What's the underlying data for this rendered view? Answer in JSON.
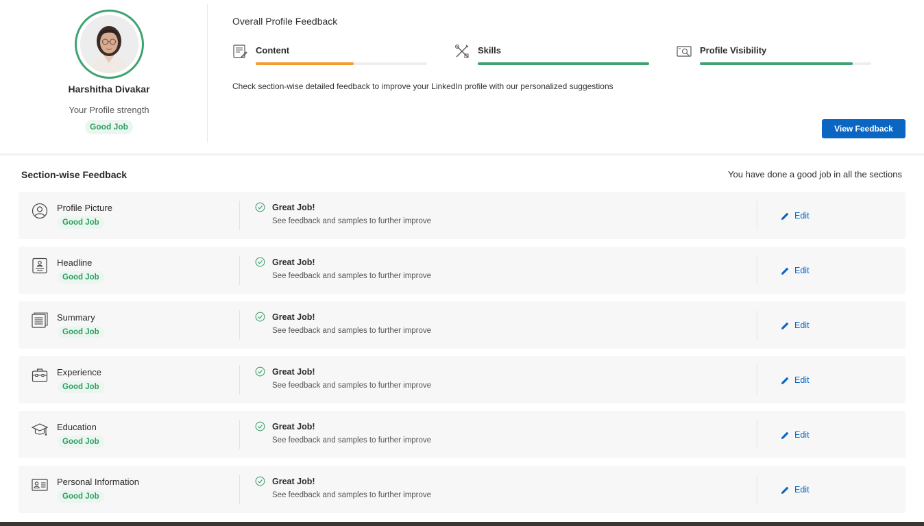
{
  "profile": {
    "name": "Harshitha Divakar",
    "strength_label": "Your Profile strength",
    "strength_badge": "Good Job",
    "ring_color": "#3ea36f"
  },
  "overall": {
    "title": "Overall Profile Feedback",
    "description": "Check section-wise detailed feedback to improve your LinkedIn profile with our personalized suggestions",
    "metrics": [
      {
        "label": "Content",
        "icon": "content-icon",
        "progress": 0.57,
        "color": "#f39c2f"
      },
      {
        "label": "Skills",
        "icon": "skills-icon",
        "progress": 1.0,
        "color": "#3ea36f"
      },
      {
        "label": "Profile Visibility",
        "icon": "profile-visibility-icon",
        "progress": 0.89,
        "color": "#3ea36f"
      }
    ],
    "view_button": "View Feedback"
  },
  "sections": {
    "title": "Section-wise Feedback",
    "summary": "You have done a good job in all the sections",
    "items": [
      {
        "name": "Profile Picture",
        "icon": "profile-picture-icon",
        "badge": "Good Job",
        "status": "Great Job!",
        "desc": "See feedback and samples to further improve",
        "edit": "Edit"
      },
      {
        "name": "Headline",
        "icon": "headline-icon",
        "badge": "Good Job",
        "status": "Great Job!",
        "desc": "See feedback and samples to further improve",
        "edit": "Edit"
      },
      {
        "name": "Summary",
        "icon": "summary-icon",
        "badge": "Good Job",
        "status": "Great Job!",
        "desc": "See feedback and samples to further improve",
        "edit": "Edit"
      },
      {
        "name": "Experience",
        "icon": "experience-icon",
        "badge": "Good Job",
        "status": "Great Job!",
        "desc": "See feedback and samples to further improve",
        "edit": "Edit"
      },
      {
        "name": "Education",
        "icon": "education-icon",
        "badge": "Good Job",
        "status": "Great Job!",
        "desc": "See feedback and samples to further improve",
        "edit": "Edit"
      },
      {
        "name": "Personal Information",
        "icon": "personal-information-icon",
        "badge": "Good Job",
        "status": "Great Job!",
        "desc": "See feedback and samples to further improve",
        "edit": "Edit"
      }
    ]
  },
  "colors": {
    "accent": "#0a66c2",
    "success": "#2e9e61",
    "warning": "#f39c2f"
  }
}
